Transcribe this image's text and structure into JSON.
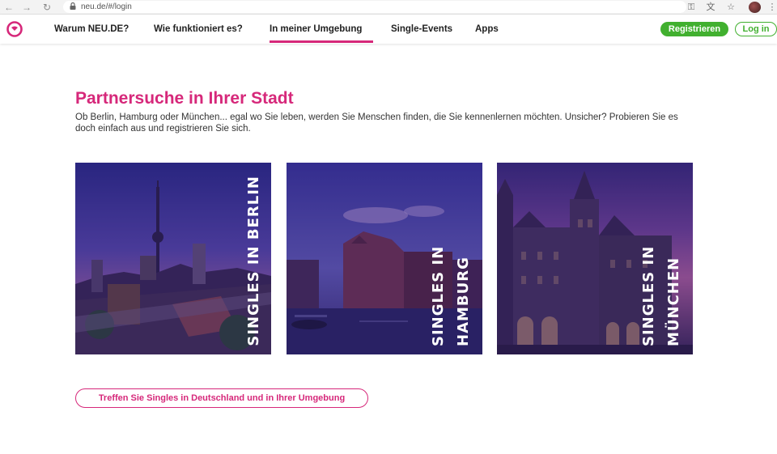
{
  "browser": {
    "url": "neu.de/#/login",
    "icons": [
      "back-icon",
      "forward-icon",
      "reload-icon",
      "lock-icon",
      "key-icon",
      "translate-icon",
      "star-icon",
      "profile-avatar",
      "menu-icon"
    ]
  },
  "header": {
    "logo": "neu-de-logo",
    "nav": [
      {
        "label": "Warum NEU.DE?"
      },
      {
        "label": "Wie funktioniert es?"
      },
      {
        "label": "In meiner Umgebung",
        "active": true
      },
      {
        "label": "Single-Events"
      },
      {
        "label": "Apps"
      }
    ],
    "register_label": "Registrieren",
    "login_label": "Log in"
  },
  "main": {
    "title": "Partnersuche in Ihrer Stadt",
    "intro": "Ob Berlin, Hamburg oder München... egal wo Sie leben, werden Sie Menschen finden, die Sie kennenlernen möchten. Unsicher? Probieren Sie es doch einfach aus und registrieren Sie sich.",
    "cities": [
      {
        "label": "Singles in Berlin"
      },
      {
        "label": "Singles in Hamburg"
      },
      {
        "label": "Singles in München"
      }
    ],
    "cta_label": "Treffen Sie Singles in Deutschland und in Ihrer Umgebung"
  },
  "colors": {
    "brand_pink": "#d6287a",
    "brand_green": "#41b02f"
  }
}
